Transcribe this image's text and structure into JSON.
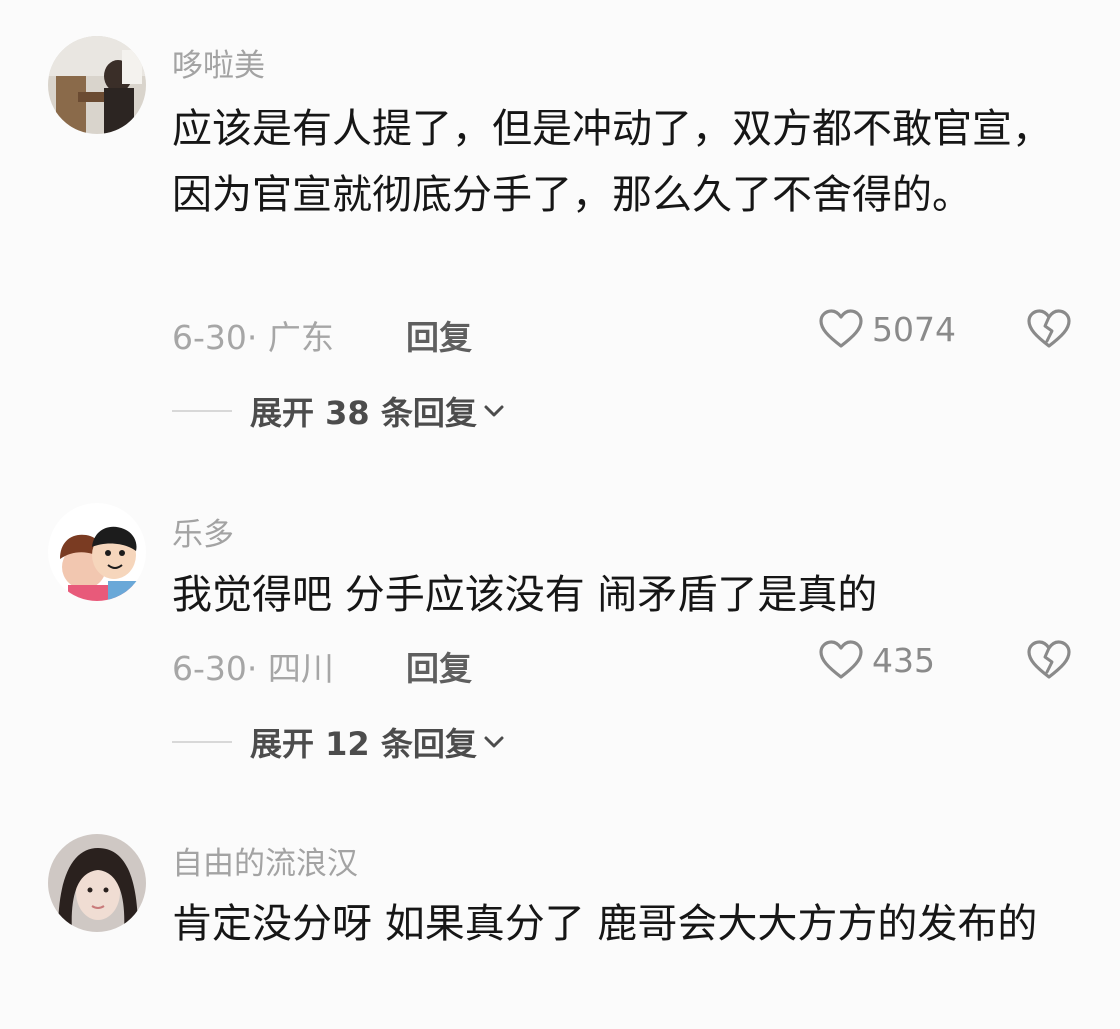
{
  "comments": [
    {
      "username": "哆啦美",
      "text": "应该是有人提了，但是冲动了，双方都不敢官宣，因为官宣就彻底分手了，那么久了不舍得的。",
      "meta": "6-30· 广东",
      "reply_label": "回复",
      "likes": "5074",
      "expand_label": "展开 38 条回复",
      "avatar_icon": "photo-avatar-icon"
    },
    {
      "username": "乐多",
      "text": "我觉得吧 分手应该没有 闹矛盾了是真的",
      "meta": "6-30· 四川",
      "reply_label": "回复",
      "likes": "435",
      "expand_label": "展开 12 条回复",
      "avatar_icon": "cartoon-avatar-icon"
    },
    {
      "username": "自由的流浪汉",
      "text": "肯定没分呀 如果真分了 鹿哥会大大方方的发布的",
      "avatar_icon": "portrait-avatar-icon"
    }
  ],
  "icons": {
    "like": "heart-outline-icon",
    "dislike": "broken-heart-icon",
    "expand": "chevron-down-icon"
  },
  "colors": {
    "background": "#fbfbfb",
    "text": "#161616",
    "muted": "#a3a3a3"
  }
}
